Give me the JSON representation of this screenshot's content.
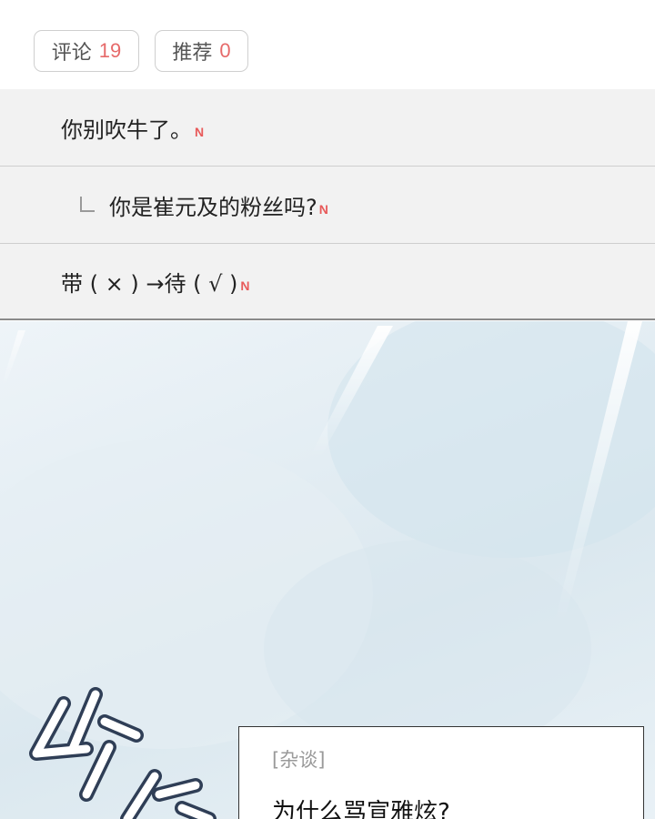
{
  "header": {
    "comments_label": "评论",
    "comments_count": "19",
    "recommend_label": "推荐",
    "recommend_count": "0"
  },
  "comments": [
    {
      "text": "你别吹牛了。",
      "is_reply": false,
      "badge": "N"
    },
    {
      "text": "你是崔元及的粉丝吗?",
      "is_reply": true,
      "badge": "N"
    },
    {
      "text": "带 ( × ) →待 ( √ )",
      "is_reply": false,
      "badge": "N"
    }
  ],
  "comic_panel": {
    "post_tag": "[杂谈]",
    "post_title": "为什么骂宣雅炫?"
  },
  "colors": {
    "count_accent": "#e66a6a",
    "new_badge": "#e85a5a",
    "comment_background": "#f2f2f2"
  }
}
